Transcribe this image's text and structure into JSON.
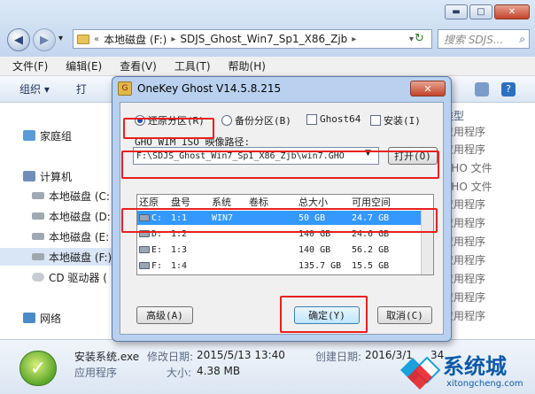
{
  "explorer": {
    "window_controls": {
      "minimize": "▬",
      "maximize": "□",
      "close": "✕"
    },
    "nav": {
      "back": "◀",
      "forward": "▶",
      "dropdown": "▾"
    },
    "breadcrumb": {
      "prefix": "«",
      "drive": "本地磁盘 (F:)",
      "folder": "SDJS_Ghost_Win7_Sp1_X86_Zjb",
      "sep": "▸",
      "dropdown": "▾"
    },
    "refresh": "↻",
    "search_placeholder": "搜索 SDJS...",
    "search_icon": "⌕",
    "menu": [
      "文件(F)",
      "编辑(E)",
      "查看(V)",
      "工具(T)",
      "帮助(H)"
    ],
    "toolbar": {
      "organize": "组织 ▾",
      "open": "打"
    },
    "sidebar": [
      {
        "label": "家庭组",
        "icon": "homegroup-icon"
      },
      {
        "label": "计算机",
        "icon": "computer-icon"
      },
      {
        "label": "本地磁盘 (C:",
        "icon": "drive-icon"
      },
      {
        "label": "本地磁盘 (D:",
        "icon": "drive-icon"
      },
      {
        "label": "本地磁盘 (E:",
        "icon": "drive-icon"
      },
      {
        "label": "本地磁盘 (F:)",
        "icon": "drive-icon"
      },
      {
        "label": "CD 驱动器 (",
        "icon": "cd-drive-icon"
      },
      {
        "label": "网络",
        "icon": "network-icon"
      }
    ],
    "column_header": "类型",
    "type_column": [
      "应用程序",
      "应用程序",
      "GHO 文件",
      "GHO 文件",
      "应用程序",
      "应用程序",
      "应用程序",
      "应用程序",
      "应用程序",
      "应用程序",
      "应用程序"
    ],
    "status": {
      "filename": "安装系统.exe",
      "modified_label": "修改日期:",
      "modified_value": "2015/5/13 13:40",
      "created_label": "创建日期:",
      "created_value": "2016/3/1",
      "created_time": "34",
      "type": "应用程序",
      "size_label": "大小:",
      "size_value": "4.38 MB"
    },
    "watermark": {
      "brand": "系统城",
      "url": "xitongcheng.com"
    }
  },
  "dialog": {
    "title": "OneKey Ghost V14.5.8.215",
    "close": "✕",
    "options": {
      "restore": "还原分区(R)",
      "backup": "备份分区(B)",
      "ghost64": "Ghost64",
      "install": "安装(I)"
    },
    "path_label": "GHO WIM ISO 映像路径:",
    "path_value": "F:\\SDJS_Ghost_Win7_Sp1_X86_Zjb\\win7.GHO",
    "open_button": "打开(O)",
    "table": {
      "headers": [
        "还原",
        "盘号",
        "系统",
        "卷标",
        "总大小",
        "可用空间"
      ],
      "rows": [
        {
          "drive": "C:",
          "disk": "1:1",
          "system": "WIN7",
          "label": "",
          "total": "50 GB",
          "free": "24.7 GB",
          "selected": true
        },
        {
          "drive": "D:",
          "disk": "1:2",
          "system": "",
          "label": "",
          "total": "140 GB",
          "free": "24.6 GB",
          "selected": false
        },
        {
          "drive": "E:",
          "disk": "1:3",
          "system": "",
          "label": "",
          "total": "140 GB",
          "free": "56.2 GB",
          "selected": false
        },
        {
          "drive": "F:",
          "disk": "1:4",
          "system": "",
          "label": "",
          "total": "135.7 GB",
          "free": "15.5 GB",
          "selected": false
        }
      ]
    },
    "advanced_button": "高级(A)",
    "ok_button": "确定(Y)",
    "cancel_button": "取消(C)"
  }
}
